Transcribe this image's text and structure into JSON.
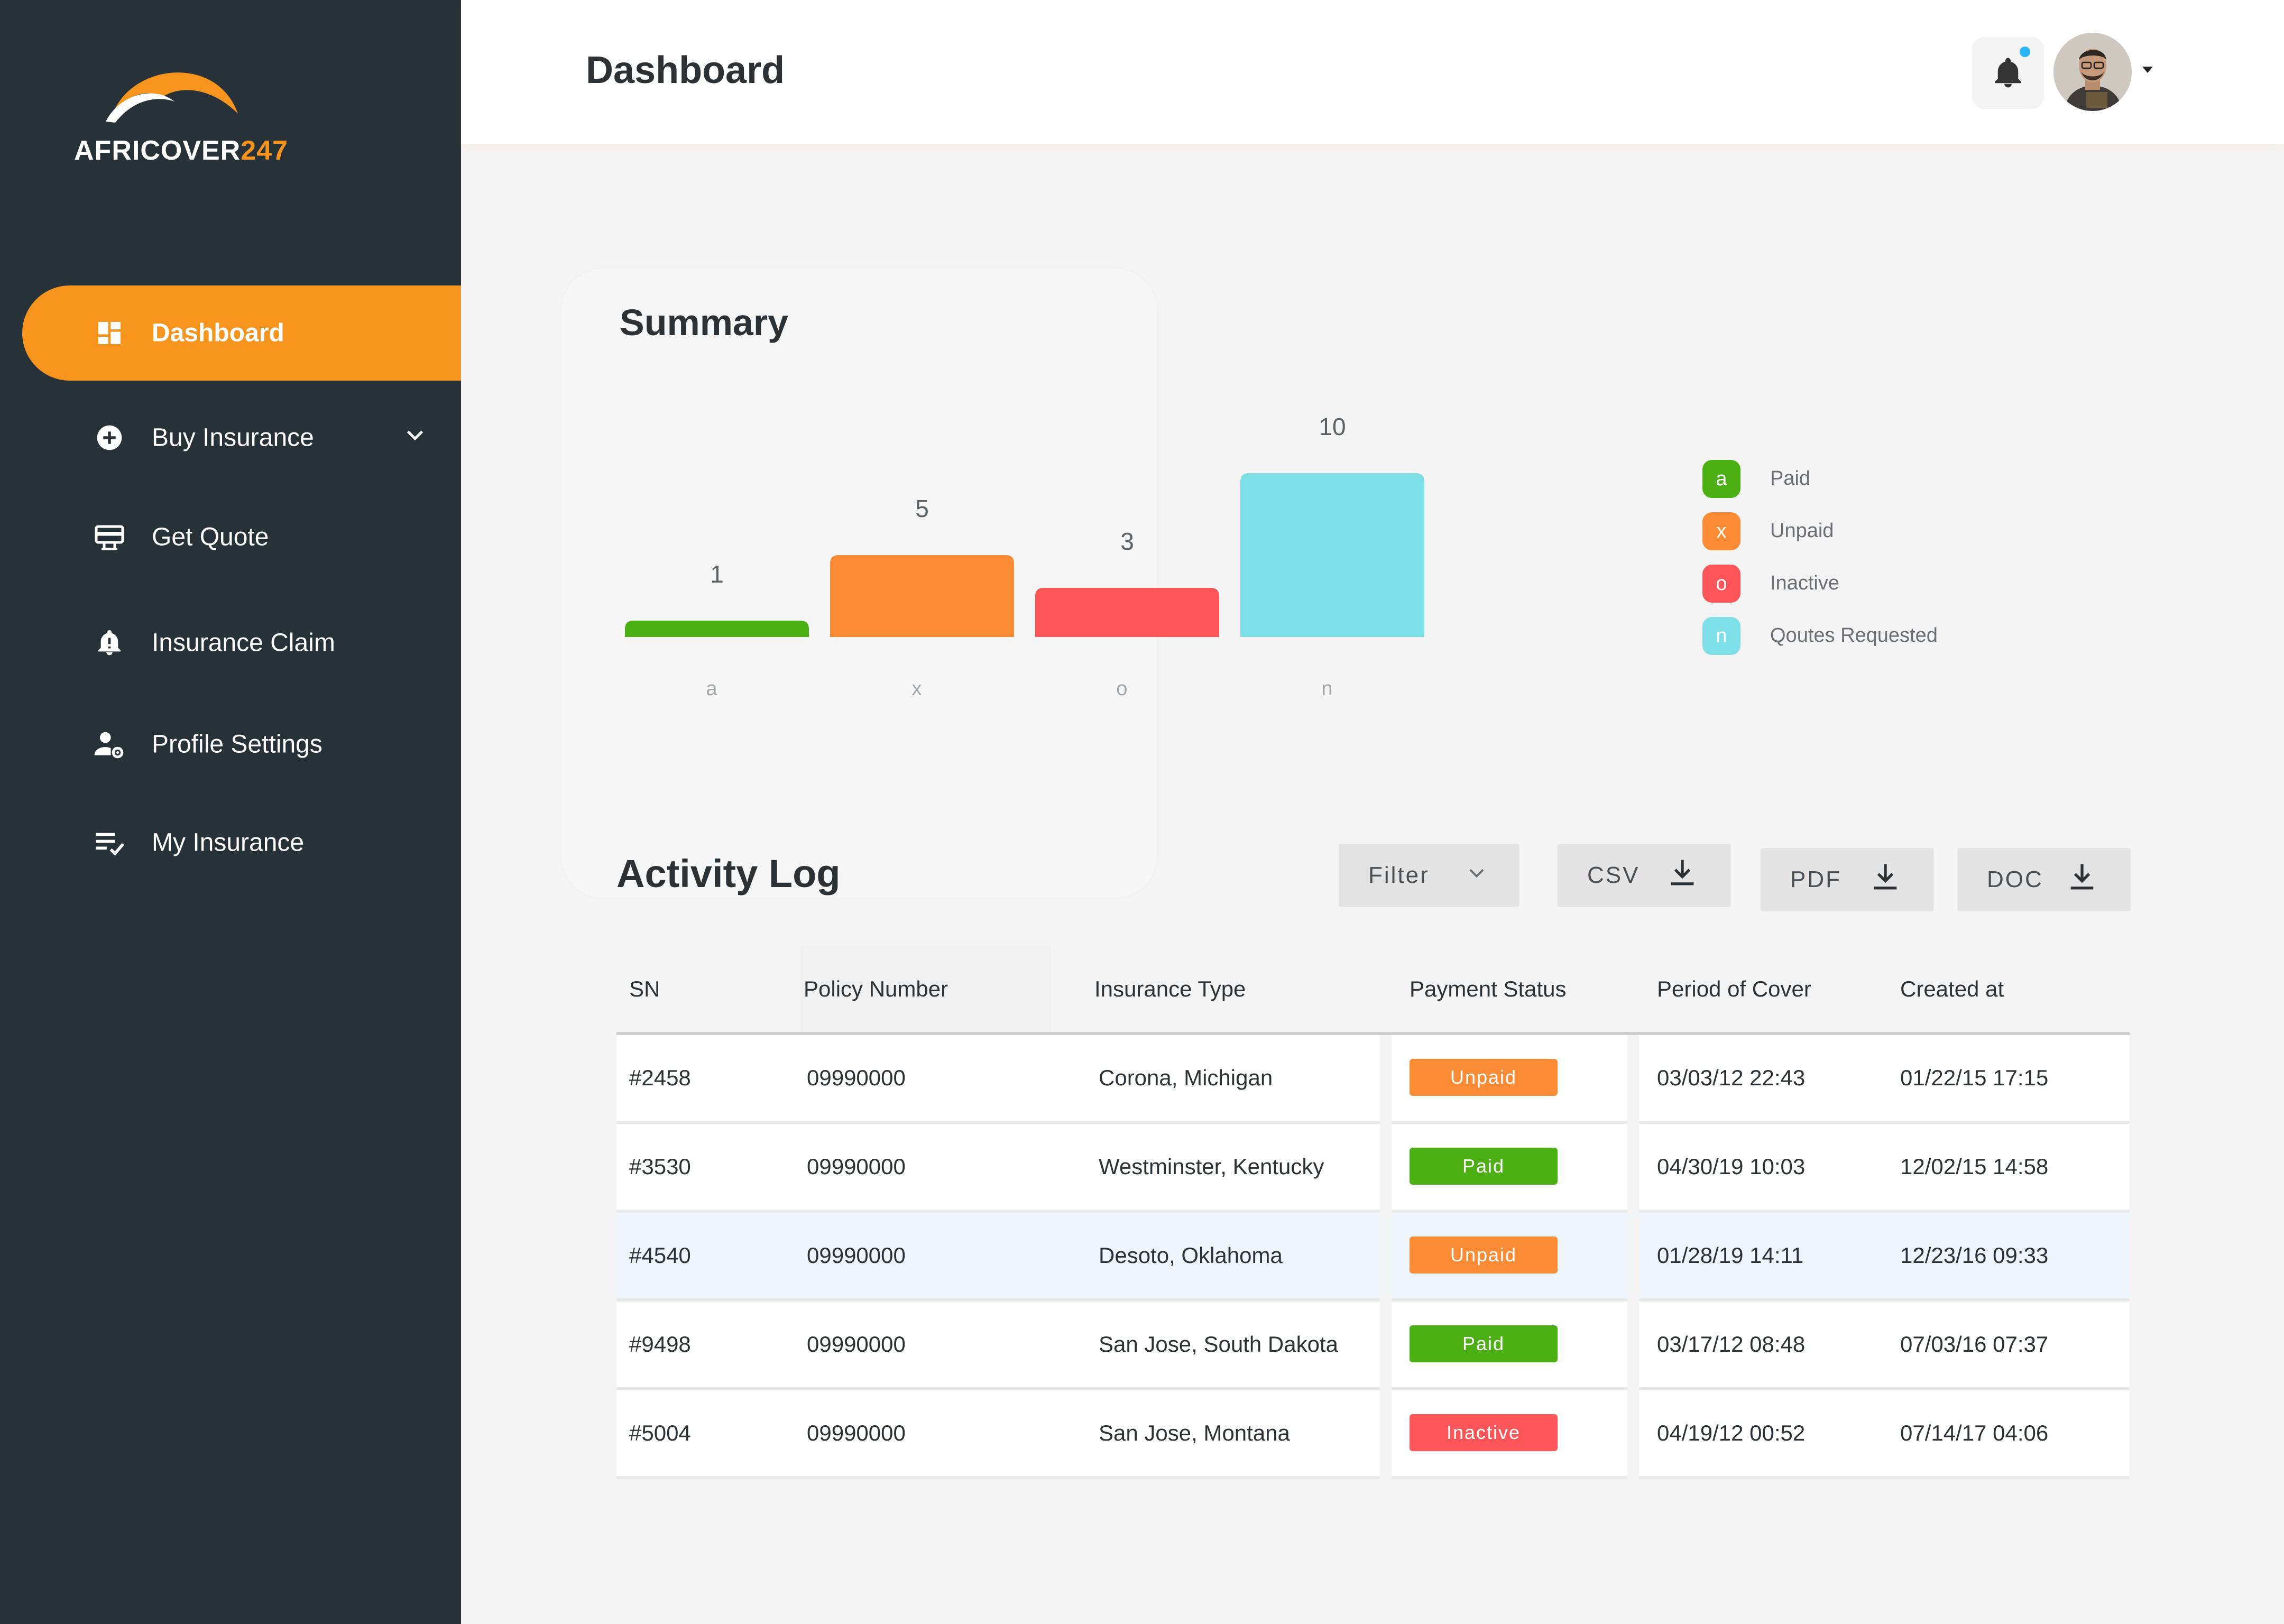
{
  "brand": {
    "name": "AFRICOVER",
    "suffix": "247"
  },
  "colors": {
    "sidebar": "#263238",
    "accent": "#f7941d",
    "paid": "#4caf14",
    "unpaid": "#fb8b35",
    "inactive": "#fd5558",
    "quotes": "#7fdfe6"
  },
  "sidebar": {
    "items": [
      {
        "label": "Dashboard",
        "icon": "dashboard-icon",
        "active": true
      },
      {
        "label": "Buy Insurance",
        "icon": "plus-circle-icon",
        "active": false,
        "expandable": true
      },
      {
        "label": "Get Quote",
        "icon": "quote-icon",
        "active": false
      },
      {
        "label": "Insurance Claim",
        "icon": "alert-bell-icon",
        "active": false
      },
      {
        "label": "Profile Settings",
        "icon": "user-settings-icon",
        "active": false
      },
      {
        "label": "My Insurance",
        "icon": "list-check-icon",
        "active": false
      }
    ]
  },
  "header": {
    "title": "Dashboard",
    "notification_icon": "bell-icon",
    "has_unread": true
  },
  "summary": {
    "title": "Summary",
    "legend": [
      {
        "key": "a",
        "label": "Paid"
      },
      {
        "key": "x",
        "label": "Unpaid"
      },
      {
        "key": "o",
        "label": "Inactive"
      },
      {
        "key": "n",
        "label": "Qoutes Requested"
      }
    ]
  },
  "chart_data": {
    "type": "bar",
    "categories": [
      "a",
      "x",
      "o",
      "n"
    ],
    "values": [
      1,
      5,
      3,
      10
    ],
    "colors": [
      "#4caf14",
      "#fb8b35",
      "#fd5558",
      "#7fdfe6"
    ],
    "data_labels": true,
    "grid": false,
    "legend_position": "right"
  },
  "activity": {
    "title": "Activity Log",
    "filter_label": "Filter",
    "exports": [
      "CSV",
      "PDF",
      "DOC"
    ],
    "columns": [
      "SN",
      "Policy Number",
      "Insurance Type",
      "Payment Status",
      "Period of Cover",
      "Created at"
    ],
    "rows": [
      {
        "sn": "#2458",
        "policy": "09990000",
        "type": "Corona, Michigan",
        "status": "Unpaid",
        "period": "03/03/12 22:43",
        "created": "01/22/15 17:15"
      },
      {
        "sn": "#3530",
        "policy": "09990000",
        "type": "Westminster, Kentucky",
        "status": "Paid",
        "period": "04/30/19 10:03",
        "created": "12/02/15 14:58"
      },
      {
        "sn": "#4540",
        "policy": "09990000",
        "type": "Desoto, Oklahoma",
        "status": "Unpaid",
        "period": "01/28/19 14:11",
        "created": "12/23/16 09:33"
      },
      {
        "sn": "#9498",
        "policy": "09990000",
        "type": "San Jose, South Dakota",
        "status": "Paid",
        "period": "03/17/12 08:48",
        "created": "07/03/16 07:37"
      },
      {
        "sn": "#5004",
        "policy": "09990000",
        "type": "San Jose, Montana",
        "status": "Inactive",
        "period": "04/19/12 00:52",
        "created": "07/14/17 04:06"
      }
    ]
  }
}
